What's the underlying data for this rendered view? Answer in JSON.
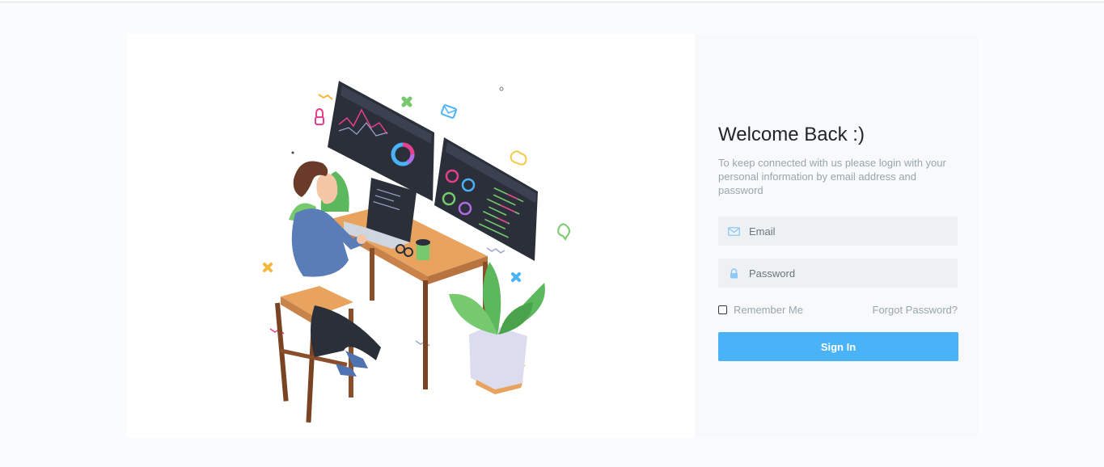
{
  "login": {
    "title": "Welcome Back :)",
    "subtitle": "To keep connected with us please login with your personal information by email address and password",
    "email_placeholder": "Email",
    "password_placeholder": "Password",
    "remember_label": "Remember Me",
    "remember_checked": false,
    "forgot_label": "Forgot Password?",
    "signin_label": "Sign In"
  },
  "icons": {
    "email": "mail-icon",
    "password": "lock-icon"
  },
  "colors": {
    "accent": "#4ab3f7",
    "input_bg": "#eef1f4",
    "panel_bg": "#f8f9fa",
    "muted_text": "#98a6ad"
  }
}
